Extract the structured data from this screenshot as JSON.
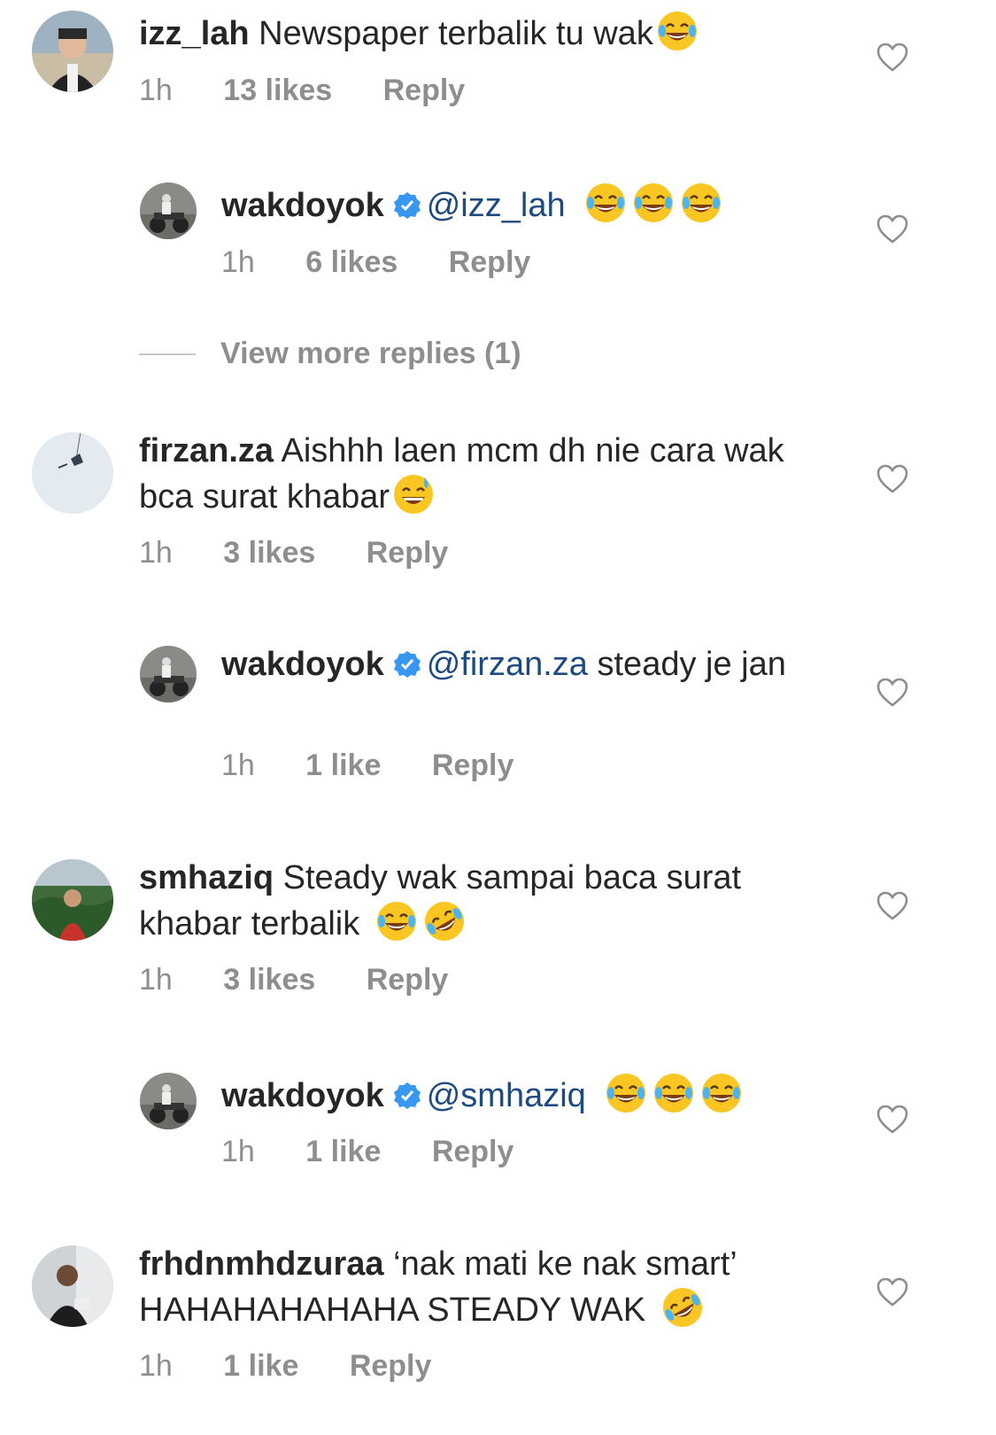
{
  "comments": [
    {
      "username": "izz_lah",
      "text": "Newspaper terbalik tu wak",
      "emojis": [
        "joy"
      ],
      "time": "1h",
      "likes": "13 likes",
      "reply_label": "Reply",
      "reply": {
        "username": "wakdoyok",
        "mention": "@izz_lah",
        "text": "",
        "emojis": [
          "joy",
          "joy",
          "joy"
        ],
        "time": "1h",
        "likes": "6 likes",
        "reply_label": "Reply"
      },
      "view_more": "View more replies (1)"
    },
    {
      "username": "firzan.za",
      "text": "Aishhh laen mcm dh nie cara wak bca surat khabar",
      "emojis": [
        "sweat_smile"
      ],
      "time": "1h",
      "likes": "3 likes",
      "reply_label": "Reply",
      "reply": {
        "username": "wakdoyok",
        "mention": "@firzan.za",
        "text": "steady je jan",
        "emojis": [],
        "time": "1h",
        "likes": "1 like",
        "reply_label": "Reply"
      }
    },
    {
      "username": "smhaziq",
      "text": "Steady wak sampai baca surat khabar terbalik",
      "emojis": [
        "joy",
        "rofl"
      ],
      "time": "1h",
      "likes": "3 likes",
      "reply_label": "Reply",
      "reply": {
        "username": "wakdoyok",
        "mention": "@smhaziq",
        "text": "",
        "emojis": [
          "joy",
          "joy",
          "joy"
        ],
        "time": "1h",
        "likes": "1 like",
        "reply_label": "Reply"
      }
    },
    {
      "username": "frhdnmhdzuraa",
      "text": "‘nak mati ke nak smart’ HAHAHAHAHAHA STEADY WAK",
      "emojis": [
        "rofl"
      ],
      "time": "1h",
      "likes": "1 like",
      "reply_label": "Reply"
    }
  ],
  "icons": {
    "like": "heart-outline-icon",
    "verified": "verified-badge-icon"
  },
  "colors": {
    "text": "#262626",
    "meta": "#8e8e8e",
    "mention": "#1e4a82",
    "verified": "#3897f0"
  }
}
